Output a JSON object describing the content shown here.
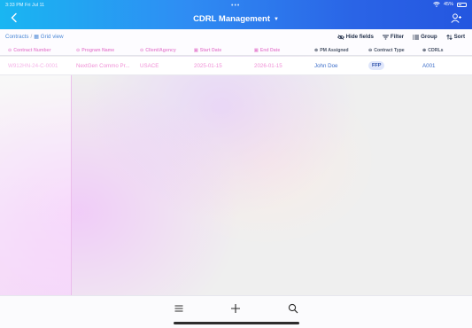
{
  "status": {
    "time": "3:33 PM   Fri Jul 11",
    "battery": "45%"
  },
  "header": {
    "title": "CDRL Management",
    "icons": [
      "back-icon",
      "chevron-down-icon",
      "add-user-icon"
    ]
  },
  "toolbar": {
    "breadcrumb_root": "Contracts",
    "breadcrumb_sep": "/",
    "breadcrumb_view": "Grid view",
    "hide_fields": "Hide fields",
    "filter": "Filter",
    "group": "Group",
    "sort": "Sort"
  },
  "columns": [
    "Contract Number",
    "Program Name",
    "Client/Agency",
    "Start Date",
    "End Date",
    "PM Assigned",
    "Contract Type",
    "CDRLs"
  ],
  "rows": [
    {
      "contract_number": "W912HN-24-C-0001",
      "program_name": "NextGen Commo Pr...",
      "client_agency": "USACE",
      "start_date": "2025-01-15",
      "end_date": "2026-01-15",
      "pm_assigned": "John Doe",
      "contract_type": "FFP",
      "cdrls": "A001"
    }
  ],
  "colors": {
    "header_start": "#19b6f2",
    "header_end": "#2456e0",
    "accent_pink": "#f08fd6",
    "link_blue": "#3d6ec9"
  }
}
